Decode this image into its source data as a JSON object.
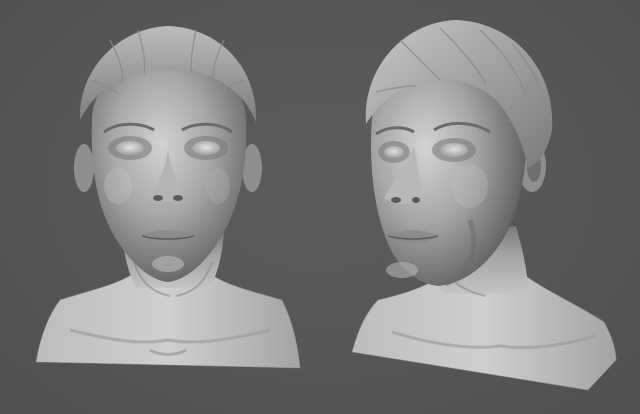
{
  "scene": {
    "background_color": "#555555",
    "material_base_color": "#9a9a9a",
    "material_highlight_color": "#d8d8d8",
    "material_shadow_color": "#3a3a3a",
    "models": [
      {
        "view": "front"
      },
      {
        "view": "three-quarter"
      }
    ]
  }
}
